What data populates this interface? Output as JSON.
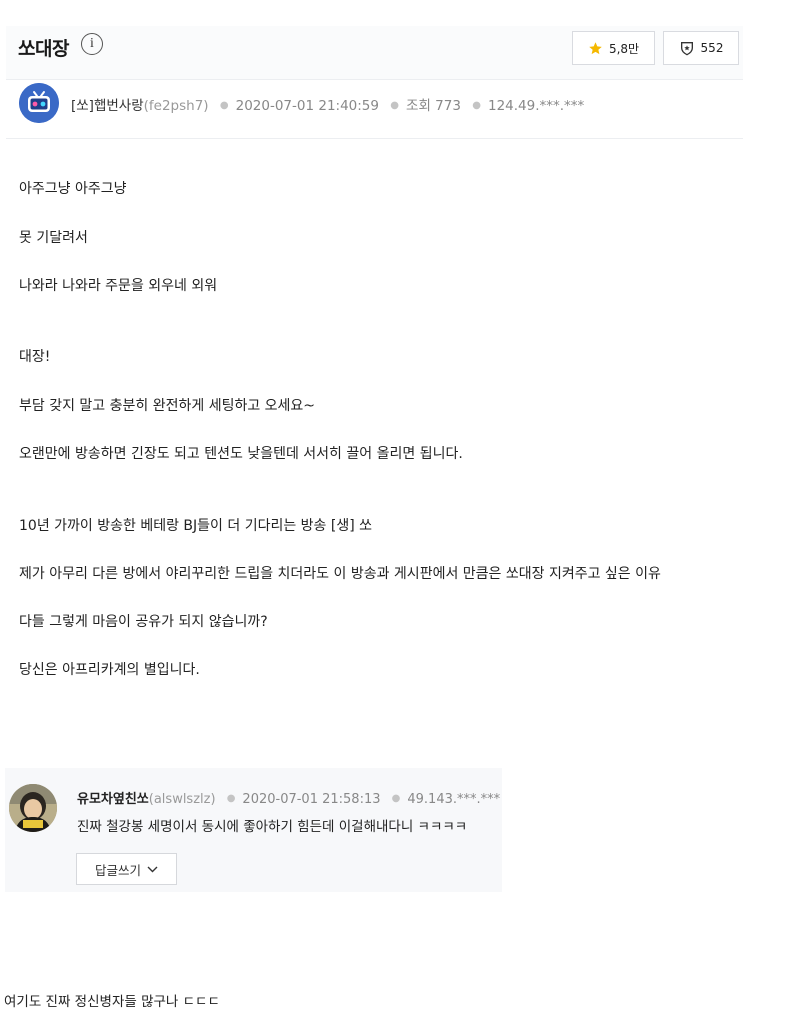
{
  "header": {
    "title": "쏘대장",
    "info_icon": "i",
    "up_count": "5,8만",
    "share_count": "552",
    "icons": {
      "up": "star-icon",
      "share": "shield-share-icon",
      "info": "info-icon"
    },
    "colors": {
      "star": "#f5b800"
    }
  },
  "post": {
    "author": "[쏘]햅번사랑",
    "author_id": "(fe2psh7)",
    "date": "2020-07-01 21:40:59",
    "views_label": "조회",
    "views": "773",
    "ip": "124.49.***.***",
    "lines": [
      "아주그냥 아주그냥",
      "못 기달려서",
      "나와라 나와라 주문을 외우네 외워",
      "대장!",
      "부담 갖지 말고 충분히 완전하게 세팅하고 오세요~",
      "오랜만에 방송하면 긴장도 되고 텐션도 낮을텐데 서서히 끌어 올리면 됩니다.",
      "10년 가까이 방송한 베테랑 BJ들이 더 기다리는 방송 [생] 쏘",
      "제가 아무리 다른 방에서 야리꾸리한 드립을 치더라도 이 방송과 게시판에서 만큼은 쏘대장 지켜주고 싶은 이유",
      "다들 그렇게 마음이 공유가 되지 않습니까?",
      "당신은 아프리카계의 별입니다."
    ]
  },
  "comment": {
    "author": "유모차옆친쏘",
    "author_id": "(alswlszlz)",
    "date": "2020-07-01 21:58:13",
    "ip": "49.143.***.***",
    "text": "진짜 철강봉 세명이서 동시에 좋아하기 힘든데 이걸해내다니 ㅋㅋㅋㅋ",
    "reply_label": "답글쓰기"
  },
  "footer": {
    "text": "여기도 진짜 정신병자들 많구나 ㄷㄷㄷ"
  }
}
